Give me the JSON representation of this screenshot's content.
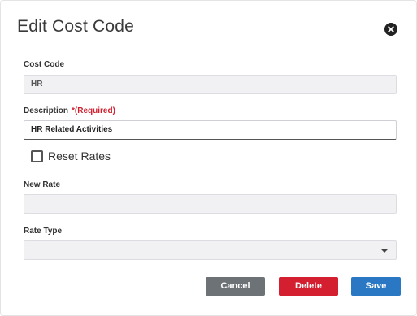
{
  "dialog": {
    "title": "Edit Cost Code"
  },
  "form": {
    "cost_code": {
      "label": "Cost Code",
      "value": "HR"
    },
    "description": {
      "label": "Description",
      "required_marker": "*(Required)",
      "value": "HR Related Activities"
    },
    "reset_rates": {
      "label": "Reset Rates",
      "checked": false
    },
    "new_rate": {
      "label": "New Rate",
      "value": ""
    },
    "rate_type": {
      "label": "Rate Type",
      "selected": ""
    }
  },
  "buttons": {
    "cancel": "Cancel",
    "delete": "Delete",
    "save": "Save"
  },
  "colors": {
    "delete": "#d31f30",
    "save": "#2a77c4",
    "cancel": "#6d7277",
    "required": "#d0202e"
  },
  "icons": {
    "close": "close-circle-icon",
    "checkbox": "checkbox-unchecked-icon",
    "dropdown": "caret-down-icon"
  }
}
